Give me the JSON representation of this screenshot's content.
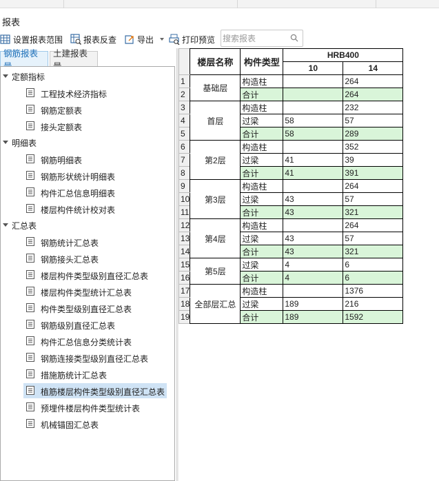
{
  "window": {
    "title": "报表"
  },
  "toolbar": {
    "set_range": "设置报表范围",
    "reverse_check": "报表反查",
    "export": "导出",
    "print_preview": "打印预览",
    "search_placeholder": "搜索报表"
  },
  "tabs": [
    {
      "label": "钢筋报表量",
      "active": true
    },
    {
      "label": "土建报表量",
      "active": false
    }
  ],
  "tree": {
    "groups": [
      {
        "label": "定额指标",
        "items": [
          "工程技术经济指标",
          "钢筋定额表",
          "接头定额表"
        ]
      },
      {
        "label": "明细表",
        "items": [
          "钢筋明细表",
          "钢筋形状统计明细表",
          "构件汇总信息明细表",
          "楼层构件统计校对表"
        ]
      },
      {
        "label": "汇总表",
        "items": [
          "钢筋统计汇总表",
          "钢筋接头汇总表",
          "楼层构件类型级别直径汇总表",
          "楼层构件类型统计汇总表",
          "构件类型级别直径汇总表",
          "钢筋级别直径汇总表",
          "构件汇总信息分类统计表",
          "钢筋连接类型级别直径汇总表",
          "措施筋统计汇总表",
          "植筋楼层构件类型级别直径汇总表",
          "预埋件楼层构件类型统计表",
          "机械锚固汇总表"
        ]
      }
    ],
    "selected": "植筋楼层构件类型级别直径汇总表"
  },
  "report": {
    "headers": {
      "floor": "楼层名称",
      "type": "构件类型",
      "steel": "HRB400",
      "d1": "10",
      "d2": "14"
    },
    "rows": [
      {
        "n": "1",
        "floor": "基础层",
        "span": 2,
        "type": "构造柱",
        "v10": "",
        "v14": "264",
        "total": false
      },
      {
        "n": "2",
        "type": "合计",
        "v10": "",
        "v14": "264",
        "total": true
      },
      {
        "n": "3",
        "floor": "首层",
        "span": 3,
        "type": "构造柱",
        "v10": "",
        "v14": "232",
        "total": false
      },
      {
        "n": "4",
        "type": "过梁",
        "v10": "58",
        "v14": "57",
        "total": false
      },
      {
        "n": "5",
        "type": "合计",
        "v10": "58",
        "v14": "289",
        "total": true
      },
      {
        "n": "6",
        "floor": "第2层",
        "span": 3,
        "type": "构造柱",
        "v10": "",
        "v14": "352",
        "total": false
      },
      {
        "n": "7",
        "type": "过梁",
        "v10": "41",
        "v14": "39",
        "total": false
      },
      {
        "n": "8",
        "type": "合计",
        "v10": "41",
        "v14": "391",
        "total": true
      },
      {
        "n": "9",
        "floor": "第3层",
        "span": 3,
        "type": "构造柱",
        "v10": "",
        "v14": "264",
        "total": false
      },
      {
        "n": "10",
        "type": "过梁",
        "v10": "43",
        "v14": "57",
        "total": false
      },
      {
        "n": "11",
        "type": "合计",
        "v10": "43",
        "v14": "321",
        "total": true
      },
      {
        "n": "12",
        "floor": "第4层",
        "span": 3,
        "type": "构造柱",
        "v10": "",
        "v14": "264",
        "total": false
      },
      {
        "n": "13",
        "type": "过梁",
        "v10": "43",
        "v14": "57",
        "total": false
      },
      {
        "n": "14",
        "type": "合计",
        "v10": "43",
        "v14": "321",
        "total": true
      },
      {
        "n": "15",
        "floor": "第5层",
        "span": 2,
        "type": "过梁",
        "v10": "4",
        "v14": "6",
        "total": false
      },
      {
        "n": "16",
        "type": "合计",
        "v10": "4",
        "v14": "6",
        "total": true
      },
      {
        "n": "17",
        "floor": "全部层汇总",
        "span": 3,
        "type": "构造柱",
        "v10": "",
        "v14": "1376",
        "total": false
      },
      {
        "n": "18",
        "type": "过梁",
        "v10": "189",
        "v14": "216",
        "total": false
      },
      {
        "n": "19",
        "type": "合计",
        "v10": "189",
        "v14": "1592",
        "total": true
      }
    ]
  },
  "colors": {
    "accent": "#1d6fb8",
    "total_bg": "#d9f5d9",
    "selected_bg": "#cfe3f5"
  }
}
